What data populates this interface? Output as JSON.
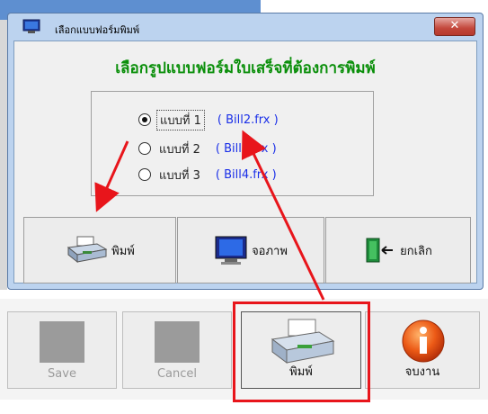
{
  "dialog": {
    "title": "เลือกแบบฟอร์มพิมพ์",
    "close_label": "✕",
    "heading": "เลือกรูปแบบฟอร์มใบเสร็จที่ต้องการพิมพ์",
    "options": [
      {
        "label": "แบบที่ 1",
        "file": "( Bill2.frx )",
        "selected": true
      },
      {
        "label": "แบบที่ 2",
        "file": "( Bill3.frx )",
        "selected": false
      },
      {
        "label": "แบบที่ 3",
        "file": "( Bill4.frx )",
        "selected": false
      }
    ],
    "buttons": {
      "print": "พิมพ์",
      "screen": "จอภาพ",
      "cancel": "ยกเลิก"
    }
  },
  "toolbar": {
    "save": "Save",
    "cancel": "Cancel",
    "print": "พิมพ์",
    "exit": "จบงาน"
  },
  "colors": {
    "heading": "#0a8f0a",
    "file_link": "#1a2fe8",
    "annotation": "#e8151b"
  }
}
